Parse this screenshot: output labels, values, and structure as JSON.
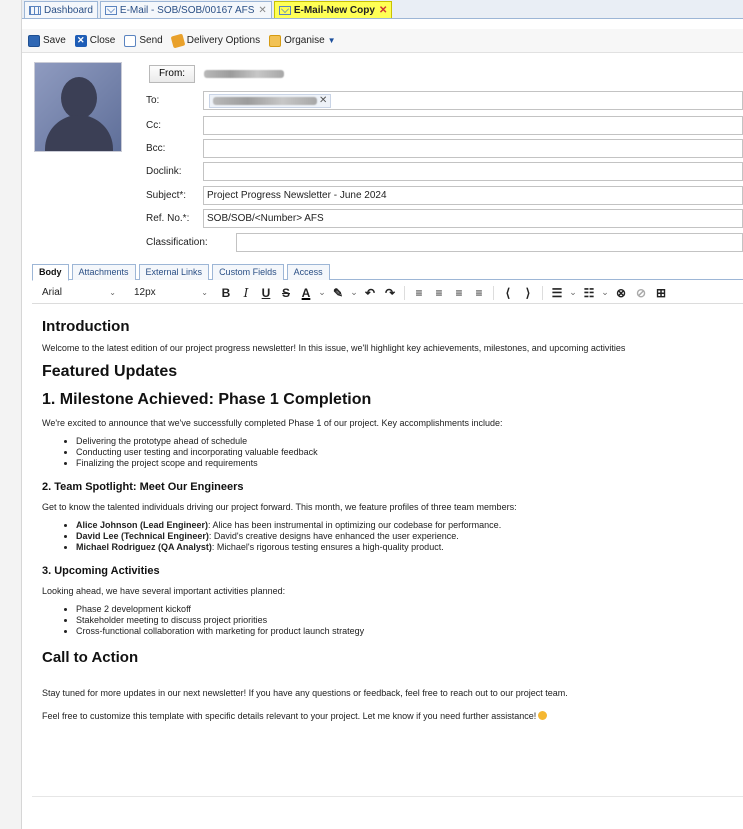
{
  "tabs": [
    {
      "label": "Dashboard",
      "icon": "grid-icon",
      "closable": false
    },
    {
      "label": "E-Mail - SOB/SOB/00167 AFS",
      "icon": "mail-icon",
      "closable": true
    },
    {
      "label": "E-Mail-New Copy",
      "icon": "mail-icon",
      "closable": true,
      "active": true
    }
  ],
  "toolbar": {
    "save": "Save",
    "close": "Close",
    "send": "Send",
    "delivery_options": "Delivery Options",
    "organise": "Organise"
  },
  "header": {
    "from_button": "From:",
    "to_label": "To:",
    "cc_label": "Cc:",
    "bcc_label": "Bcc:",
    "doclink_label": "Doclink:",
    "subject_label": "Subject*:",
    "subject_value": "Project Progress Newsletter - June 2024",
    "refno_label": "Ref. No.*:",
    "refno_value": "SOB/SOB/<Number> AFS",
    "classification_label": "Classification:"
  },
  "body_tabs": [
    "Body",
    "Attachments",
    "External Links",
    "Custom Fields",
    "Access"
  ],
  "editor_toolbar": {
    "font": "Arial",
    "size": "12px"
  },
  "content": {
    "intro_heading": "Introduction",
    "intro_text": "Welcome to the latest edition of our project progress newsletter! In this issue, we'll highlight key achievements, milestones, and upcoming activities",
    "featured_heading": "Featured Updates",
    "milestone_heading": "1. Milestone Achieved: Phase 1 Completion",
    "milestone_text": "We're excited to announce that we've successfully completed Phase 1 of our project. Key accomplishments include:",
    "milestone_items": [
      "Delivering the prototype ahead of schedule",
      "Conducting user testing and incorporating valuable feedback",
      "Finalizing the project scope and requirements"
    ],
    "team_heading": "2. Team Spotlight: Meet Our Engineers",
    "team_text": "Get to know the talented individuals driving our project forward. This month, we feature profiles of three team members:",
    "team_items": [
      {
        "name": "Alice Johnson (Lead Engineer)",
        "desc": ": Alice has been instrumental in optimizing our codebase for performance."
      },
      {
        "name": "David Lee (Technical Engineer)",
        "desc": ": David's creative designs have enhanced the user experience."
      },
      {
        "name": "Michael Rodriguez (QA Analyst)",
        "desc": ": Michael's rigorous testing ensures a high-quality product."
      }
    ],
    "upcoming_heading": "3. Upcoming Activities",
    "upcoming_text": "Looking ahead, we have several important activities planned:",
    "upcoming_items": [
      "Phase 2 development kickoff",
      "Stakeholder meeting to discuss project priorities",
      "Cross-functional collaboration with marketing for product launch strategy"
    ],
    "cta_heading": "Call to Action",
    "cta_text": "Stay tuned for more updates in our next newsletter! If you have any questions or feedback, feel free to reach out to our project team.",
    "closing_text": "Feel free to customize this template with specific details relevant to your project. Let me know if you need further assistance!"
  }
}
